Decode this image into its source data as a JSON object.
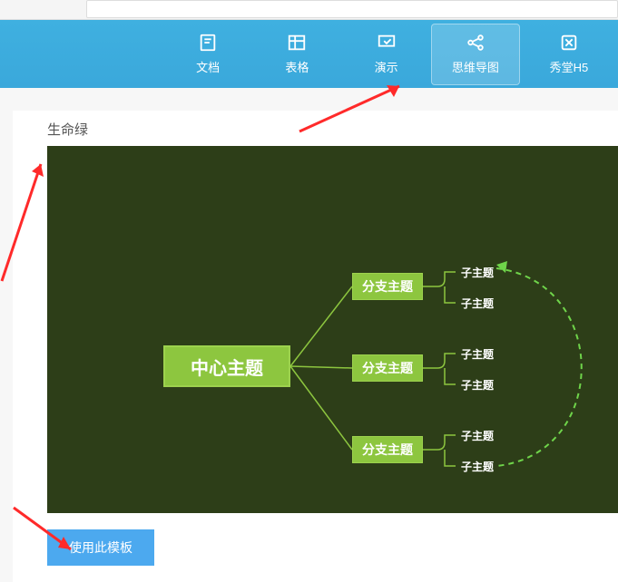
{
  "nav": {
    "items": [
      {
        "label": "文档"
      },
      {
        "label": "表格"
      },
      {
        "label": "演示"
      },
      {
        "label": "思维导图"
      },
      {
        "label": "秀堂H5"
      }
    ]
  },
  "template": {
    "title": "生命绿",
    "use_button": "使用此模板"
  },
  "mindmap": {
    "center": "中心主题",
    "branches": [
      {
        "label": "分支主题",
        "subs": [
          "子主题",
          "子主题"
        ]
      },
      {
        "label": "分支主题",
        "subs": [
          "子主题",
          "子主题"
        ]
      },
      {
        "label": "分支主题",
        "subs": [
          "子主题",
          "子主题"
        ]
      }
    ]
  },
  "colors": {
    "nav_bg": "#3aa8db",
    "node_bg": "#8dc63f",
    "preview_bg": "#2d3e18",
    "btn_bg": "#4ca9ef",
    "arrow": "#ff2a2a"
  }
}
